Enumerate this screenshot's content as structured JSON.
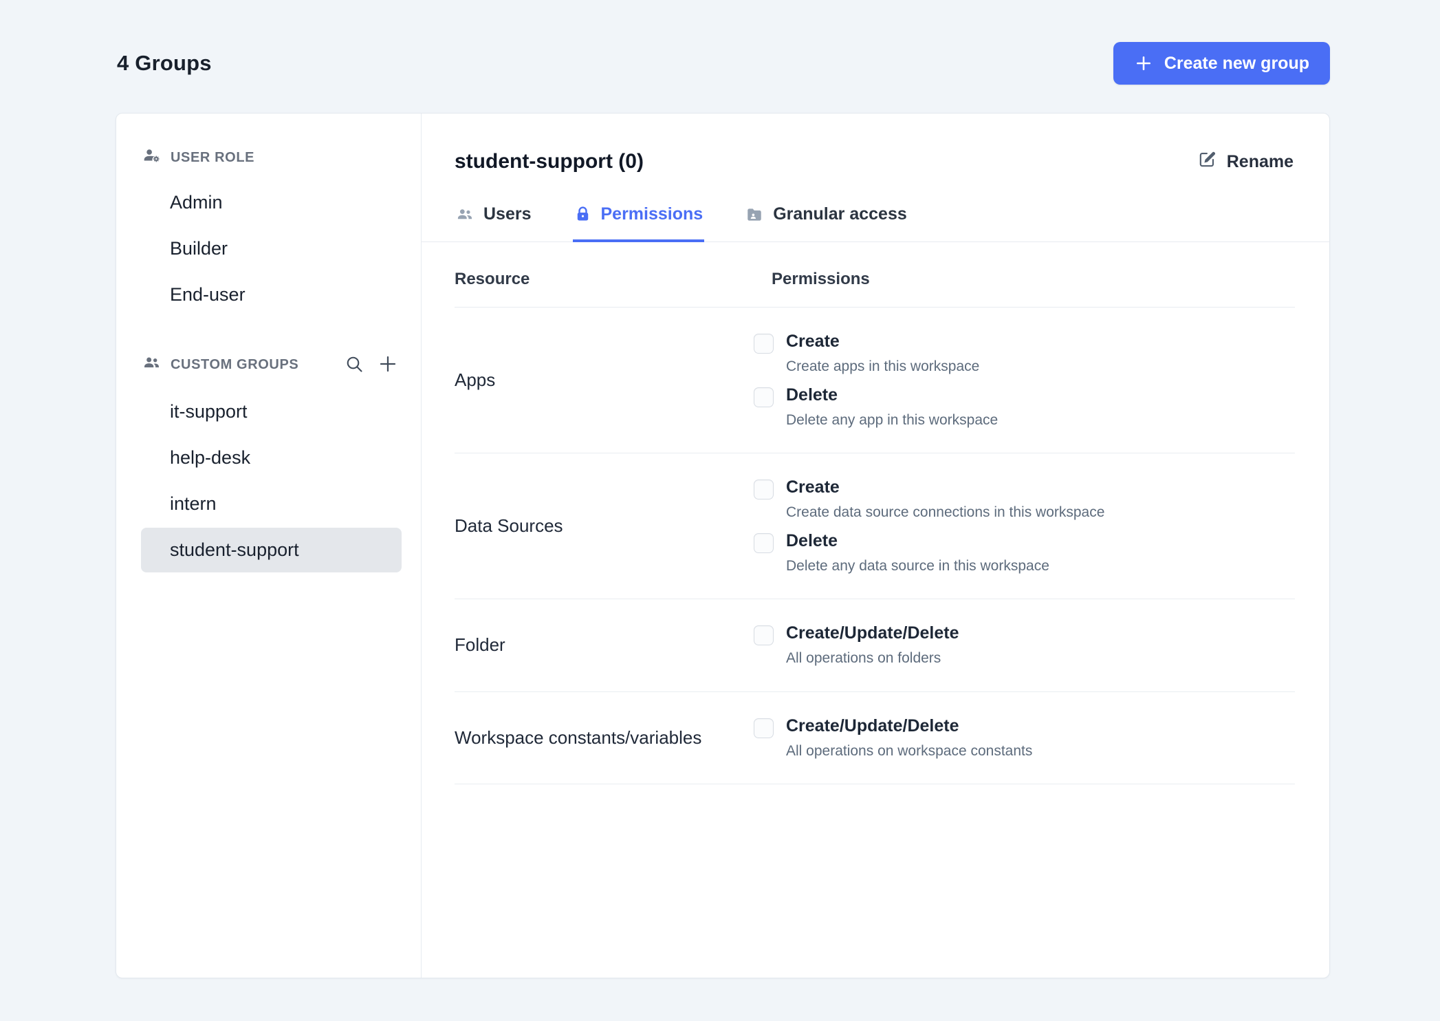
{
  "colors": {
    "primary": "#4A6EF5",
    "page_background": "#F1F5F9",
    "card_background": "#FFFFFF",
    "selected_item_background": "#E4E7EB",
    "text_primary": "#1F2633",
    "text_muted": "#5D6B7C"
  },
  "header": {
    "title": "4 Groups",
    "create_button": {
      "label": "Create new group",
      "icon": "plus-icon"
    }
  },
  "sidebar": {
    "user_role": {
      "header": "USER ROLE",
      "icon": "user-gear-icon",
      "items": [
        {
          "label": "Admin",
          "selected": false
        },
        {
          "label": "Builder",
          "selected": false
        },
        {
          "label": "End-user",
          "selected": false
        }
      ]
    },
    "custom_groups": {
      "header": "CUSTOM GROUPS",
      "icon": "people-icon",
      "actions": [
        {
          "icon": "search-icon"
        },
        {
          "icon": "plus-icon"
        }
      ],
      "items": [
        {
          "label": "it-support",
          "selected": false
        },
        {
          "label": "help-desk",
          "selected": false
        },
        {
          "label": "intern",
          "selected": false
        },
        {
          "label": "student-support",
          "selected": true
        }
      ]
    }
  },
  "main": {
    "title": "student-support (0)",
    "rename_button": {
      "label": "Rename",
      "icon": "edit-icon"
    },
    "tabs": [
      {
        "label": "Users",
        "icon": "users-icon",
        "active": false
      },
      {
        "label": "Permissions",
        "icon": "lock-icon",
        "active": true
      },
      {
        "label": "Granular access",
        "icon": "folder-icon",
        "active": false
      }
    ],
    "permissions_table": {
      "headers": {
        "resource": "Resource",
        "permissions": "Permissions"
      },
      "rows": [
        {
          "resource": "Apps",
          "permissions": [
            {
              "label": "Create",
              "description": "Create apps in this workspace",
              "checked": false
            },
            {
              "label": "Delete",
              "description": "Delete any app in this workspace",
              "checked": false
            }
          ]
        },
        {
          "resource": "Data Sources",
          "permissions": [
            {
              "label": "Create",
              "description": "Create data source connections in this workspace",
              "checked": false
            },
            {
              "label": "Delete",
              "description": "Delete any data source in this workspace",
              "checked": false
            }
          ]
        },
        {
          "resource": "Folder",
          "permissions": [
            {
              "label": "Create/Update/Delete",
              "description": "All operations on folders",
              "checked": false
            }
          ]
        },
        {
          "resource": "Workspace constants/variables",
          "permissions": [
            {
              "label": "Create/Update/Delete",
              "description": "All operations on workspace constants",
              "checked": false
            }
          ]
        }
      ]
    }
  }
}
